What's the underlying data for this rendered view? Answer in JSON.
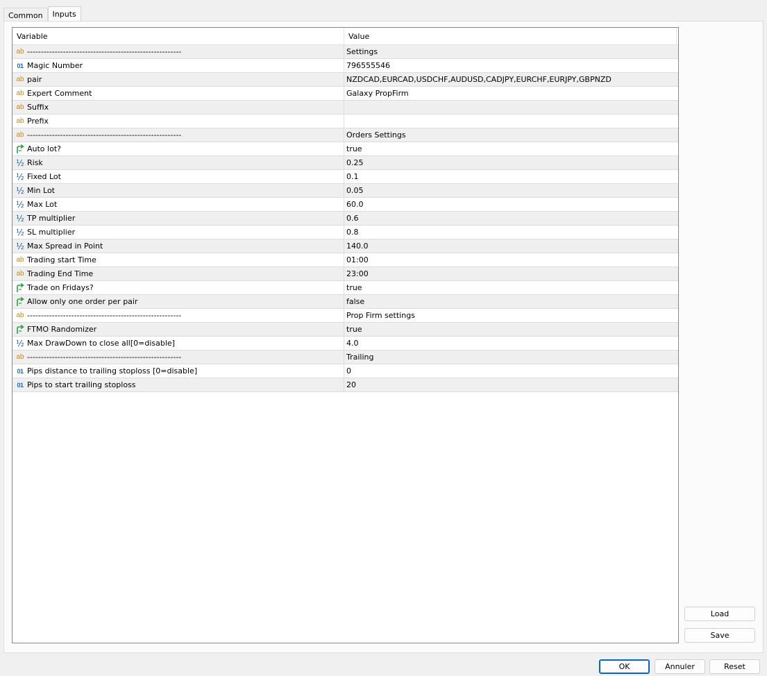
{
  "tabs": [
    {
      "label": "Common",
      "active": false
    },
    {
      "label": "Inputs",
      "active": true
    }
  ],
  "grid": {
    "columns": {
      "variable": "Variable",
      "value": "Value"
    },
    "rows": [
      {
        "type": "string",
        "icon": "ab-icon",
        "variable": "--------------------------------------------------------",
        "value": "Settings"
      },
      {
        "type": "int",
        "icon": "int-icon",
        "variable": "Magic Number",
        "value": "796555546"
      },
      {
        "type": "string",
        "icon": "ab-icon",
        "variable": "pair",
        "value": "NZDCAD,EURCAD,USDCHF,AUDUSD,CADJPY,EURCHF,EURJPY,GBPNZD"
      },
      {
        "type": "string",
        "icon": "ab-icon",
        "variable": "Expert Comment",
        "value": "Galaxy PropFirm"
      },
      {
        "type": "string",
        "icon": "ab-icon",
        "variable": "Suffix",
        "value": ""
      },
      {
        "type": "string",
        "icon": "ab-icon",
        "variable": "Prefix",
        "value": ""
      },
      {
        "type": "string",
        "icon": "ab-icon",
        "variable": "--------------------------------------------------------",
        "value": "Orders Settings"
      },
      {
        "type": "bool",
        "icon": "bool-arrow-icon",
        "variable": "Auto lot?",
        "value": "true"
      },
      {
        "type": "double",
        "icon": "half-icon",
        "variable": "Risk",
        "value": "0.25"
      },
      {
        "type": "double",
        "icon": "half-icon",
        "variable": "Fixed Lot",
        "value": "0.1"
      },
      {
        "type": "double",
        "icon": "half-icon",
        "variable": "Min Lot",
        "value": "0.05"
      },
      {
        "type": "double",
        "icon": "half-icon",
        "variable": "Max Lot",
        "value": "60.0"
      },
      {
        "type": "double",
        "icon": "half-icon",
        "variable": "TP multiplier",
        "value": "0.6"
      },
      {
        "type": "double",
        "icon": "half-icon",
        "variable": "SL multiplier",
        "value": "0.8"
      },
      {
        "type": "double",
        "icon": "half-icon",
        "variable": "Max Spread in Point",
        "value": "140.0"
      },
      {
        "type": "string",
        "icon": "ab-icon",
        "variable": "Trading start Time",
        "value": "01:00"
      },
      {
        "type": "string",
        "icon": "ab-icon",
        "variable": "Trading End Time",
        "value": "23:00"
      },
      {
        "type": "bool",
        "icon": "bool-arrow-icon",
        "variable": "Trade on Fridays?",
        "value": "true"
      },
      {
        "type": "bool",
        "icon": "bool-arrow-icon",
        "variable": "Allow only one order per pair",
        "value": "false"
      },
      {
        "type": "string",
        "icon": "ab-icon",
        "variable": "--------------------------------------------------------",
        "value": "Prop Firm settings"
      },
      {
        "type": "bool",
        "icon": "bool-arrow-icon",
        "variable": "FTMO Randomizer",
        "value": "true"
      },
      {
        "type": "double",
        "icon": "half-icon",
        "variable": "Max DrawDown to close all[0=disable]",
        "value": "4.0"
      },
      {
        "type": "string",
        "icon": "ab-icon",
        "variable": "--------------------------------------------------------",
        "value": "Trailing"
      },
      {
        "type": "int",
        "icon": "int-icon",
        "variable": "Pips distance to trailing stoploss [0=disable]",
        "value": "0"
      },
      {
        "type": "int",
        "icon": "int-icon",
        "variable": "Pips to start trailing stoploss",
        "value": "20"
      }
    ]
  },
  "icon_glyphs": {
    "string": "ab",
    "int": "01",
    "double": "½"
  },
  "side_buttons": {
    "load": "Load",
    "save": "Save"
  },
  "footer_buttons": {
    "ok": "OK",
    "cancel": "Annuler",
    "reset": "Reset"
  },
  "colors": {
    "string_icon": "#c78a1c",
    "int_icon": "#1c6ab8",
    "bool_icon": "#2ea043",
    "primary_border": "#0067c0"
  }
}
